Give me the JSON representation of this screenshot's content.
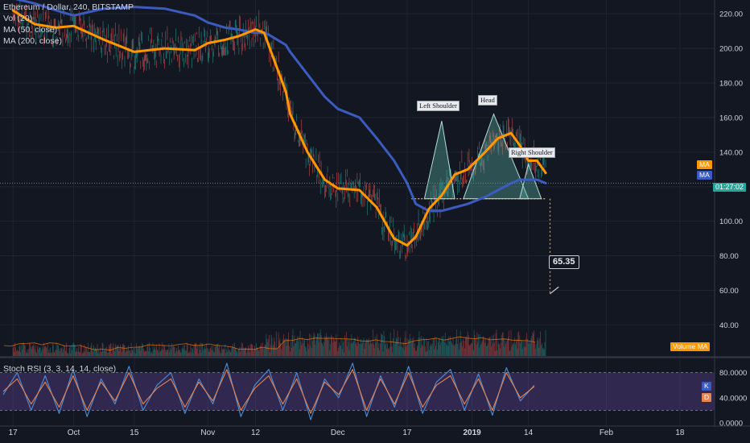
{
  "header": {
    "symbol_line": "Ethereum / Dollar, 240, BITSTAMP",
    "indicators": [
      "Vol (20)",
      "MA (50, close)",
      "MA (200, close)"
    ]
  },
  "rsi_label": "Stoch RSI (3, 3, 14, 14, close)",
  "annotations": {
    "left_shoulder": "Left Shoulder",
    "head": "Head",
    "right_shoulder": "Right Shoulder",
    "target": "65.35"
  },
  "price_pills": {
    "ma1": "MA",
    "ma2": "MA",
    "countdown": "01:27:02",
    "volume_ma": "Volume MA",
    "rsi_k": "K",
    "rsi_d": "D"
  },
  "colors": {
    "background": "#131722",
    "grid": "#1f2430",
    "ma50": "#ff9800",
    "ma200": "#3c5bbf",
    "pattern_fill": "#5fb9b0",
    "candle_up": "#26a69a",
    "candle_down": "#ef5350",
    "rsi_band": "#7e57c2",
    "rsi_k": "#4f8fd6",
    "rsi_d": "#e8854f",
    "text": "#d1d4dc"
  },
  "chart_data": [
    {
      "type": "line",
      "title": "Ethereum / Dollar, 240, BITSTAMP",
      "xlabel": "",
      "ylabel": "",
      "x_tick_labels": [
        "17",
        "Oct",
        "15",
        "Nov",
        "12",
        "Dec",
        "17",
        "2019",
        "14",
        "Feb",
        "18"
      ],
      "y_tick_labels": [
        "220.00",
        "200.00",
        "180.00",
        "160.00",
        "140.00",
        "120.00",
        "100.00",
        "80.00",
        "60.00",
        "40.00"
      ],
      "ylim": [
        22,
        228
      ],
      "grid": true,
      "x_dates": [
        "2018-09-17",
        "2018-09-22",
        "2018-09-27",
        "2018-10-01",
        "2018-10-08",
        "2018-10-15",
        "2018-10-22",
        "2018-10-29",
        "2018-11-01",
        "2018-11-05",
        "2018-11-08",
        "2018-11-12",
        "2018-11-14",
        "2018-11-15",
        "2018-11-19",
        "2018-11-20",
        "2018-11-24",
        "2018-11-28",
        "2018-12-01",
        "2018-12-06",
        "2018-12-10",
        "2018-12-14",
        "2018-12-17",
        "2018-12-19",
        "2018-12-22",
        "2018-12-25",
        "2018-12-28",
        "2018-12-31",
        "2019-01-04",
        "2019-01-07",
        "2019-01-10",
        "2019-01-12",
        "2019-01-14",
        "2019-01-16",
        "2019-01-18"
      ],
      "series": [
        {
          "name": "MA (50, close)",
          "values": [
            222,
            214,
            212,
            213,
            205,
            198,
            200,
            199,
            203,
            205,
            207,
            211,
            209,
            202,
            175,
            162,
            140,
            124,
            119,
            118,
            108,
            90,
            86,
            91,
            107,
            115,
            127,
            130,
            140,
            148,
            151,
            144,
            135,
            135,
            128
          ]
        },
        {
          "name": "MA (200, close)",
          "values": [
            229,
            226,
            222,
            219,
            223,
            224,
            223,
            219,
            215,
            212,
            211,
            209,
            209,
            208,
            202,
            198,
            185,
            172,
            165,
            160,
            148,
            135,
            122,
            110,
            106,
            106,
            108,
            110,
            114,
            118,
            122,
            124,
            124,
            124,
            122
          ]
        }
      ]
    },
    {
      "type": "line",
      "title": "Stoch RSI (3, 3, 14, 14, close)",
      "y_tick_labels": [
        "80.0000",
        "40.0000",
        "0.0000"
      ],
      "ylim": [
        0,
        100
      ],
      "band": [
        20,
        80
      ],
      "series": [
        {
          "name": "K",
          "values": [
            45,
            80,
            20,
            75,
            15,
            85,
            10,
            70,
            30,
            90,
            20,
            60,
            80,
            15,
            70,
            30,
            95,
            10,
            60,
            85,
            20,
            80,
            5,
            70,
            40,
            95,
            10,
            75,
            25,
            90,
            15,
            65,
            85,
            20,
            78,
            12,
            88,
            35,
            60
          ]
        },
        {
          "name": "D",
          "values": [
            50,
            70,
            30,
            65,
            25,
            75,
            20,
            65,
            35,
            80,
            30,
            55,
            70,
            25,
            65,
            35,
            85,
            20,
            55,
            75,
            30,
            70,
            15,
            65,
            45,
            85,
            20,
            70,
            30,
            80,
            25,
            60,
            75,
            30,
            70,
            20,
            80,
            40,
            58
          ]
        }
      ]
    }
  ]
}
